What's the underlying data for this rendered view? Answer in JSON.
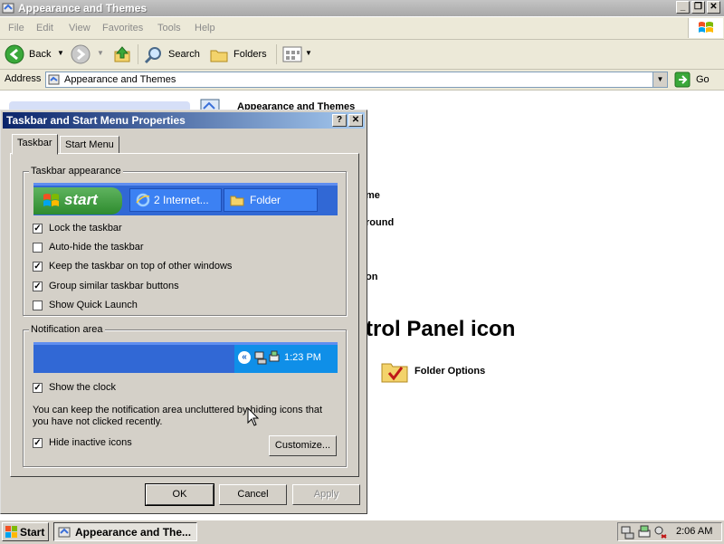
{
  "explorer": {
    "title": "Appearance and Themes",
    "menu": [
      "File",
      "Edit",
      "View",
      "Favorites",
      "Tools",
      "Help"
    ],
    "toolbar": {
      "back": "Back",
      "search": "Search",
      "folders": "Folders"
    },
    "address": {
      "label": "Address",
      "value": "Appearance and Themes",
      "go": "Go"
    },
    "content": {
      "heading": "Appearance and Themes",
      "item1_fragment": "me",
      "item2_fragment": "round",
      "item3_fragment": "on",
      "big_title_fragment": "trol Panel icon",
      "folder_options": "Folder Options"
    }
  },
  "dialog": {
    "title": "Taskbar and Start Menu Properties",
    "tabs": [
      "Taskbar",
      "Start Menu"
    ],
    "taskbar_appearance": {
      "label": "Taskbar appearance",
      "start_label": "start",
      "task1": "2 Internet...",
      "task2": "Folder",
      "options": [
        {
          "label": "Lock the taskbar",
          "checked": true
        },
        {
          "label": "Auto-hide the taskbar",
          "checked": false
        },
        {
          "label": "Keep the taskbar on top of other windows",
          "checked": true
        },
        {
          "label": "Group similar taskbar buttons",
          "checked": true
        },
        {
          "label": "Show Quick Launch",
          "checked": false
        }
      ]
    },
    "notification_area": {
      "label": "Notification area",
      "clock": "1:23 PM",
      "show_clock": {
        "label": "Show the clock",
        "checked": true
      },
      "description": "You can keep the notification area uncluttered by hiding icons that you have not clicked recently.",
      "hide_inactive": {
        "label": "Hide inactive icons",
        "checked": true
      },
      "customize": "Customize..."
    },
    "buttons": {
      "ok": "OK",
      "cancel": "Cancel",
      "apply": "Apply"
    }
  },
  "taskbar": {
    "start": "Start",
    "window": "Appearance and The...",
    "time": "2:06 AM"
  },
  "colors": {
    "dialog_title": "#0a246a",
    "xp_taskbar": "#3168d5",
    "start_green": "#2e8b2e"
  }
}
